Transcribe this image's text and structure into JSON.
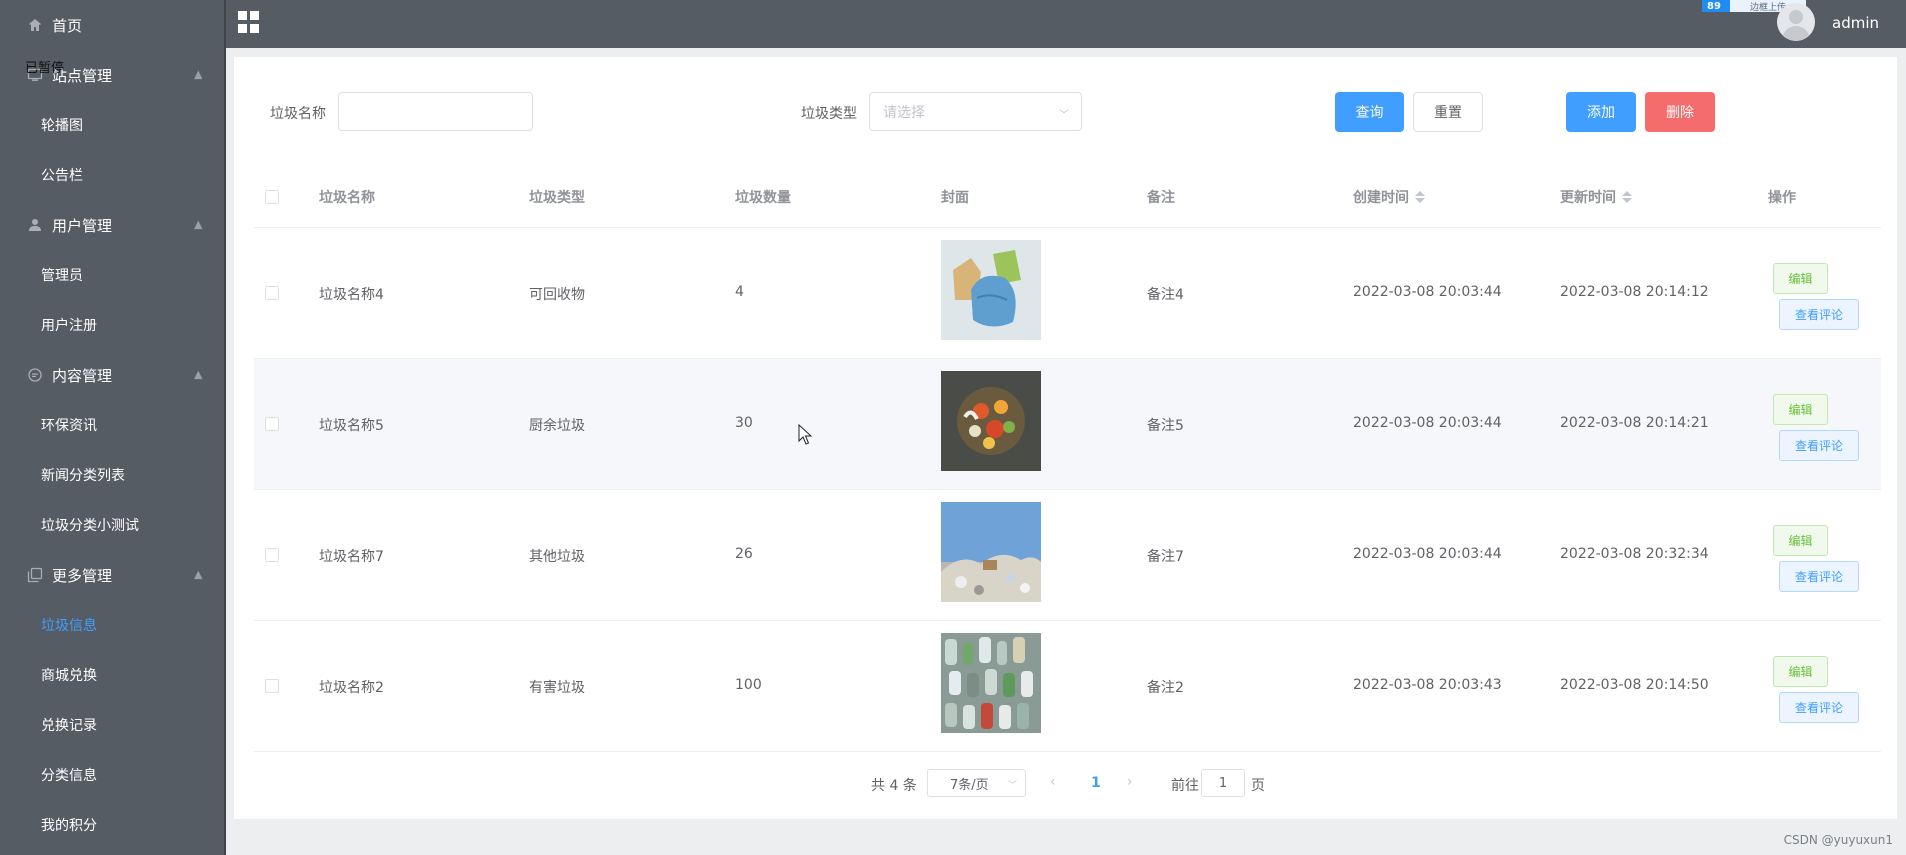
{
  "sidebar": {
    "paused_label": "已暂停",
    "items": [
      {
        "label": "首页",
        "icon": "home-icon",
        "type": "menu"
      },
      {
        "label": "站点管理",
        "icon": "monitor-icon",
        "type": "menu",
        "expanded": true
      },
      {
        "label": "轮播图",
        "type": "sub"
      },
      {
        "label": "公告栏",
        "type": "sub"
      },
      {
        "label": "用户管理",
        "icon": "user-icon",
        "type": "menu",
        "expanded": true
      },
      {
        "label": "管理员",
        "type": "sub"
      },
      {
        "label": "用户注册",
        "type": "sub"
      },
      {
        "label": "内容管理",
        "icon": "chat-icon",
        "type": "menu",
        "expanded": true
      },
      {
        "label": "环保资讯",
        "type": "sub"
      },
      {
        "label": "新闻分类列表",
        "type": "sub"
      },
      {
        "label": "垃圾分类小测试",
        "type": "sub"
      },
      {
        "label": "更多管理",
        "icon": "copy-icon",
        "type": "menu",
        "expanded": true
      },
      {
        "label": "垃圾信息",
        "type": "sub",
        "active": true
      },
      {
        "label": "商城兑换",
        "type": "sub"
      },
      {
        "label": "兑换记录",
        "type": "sub"
      },
      {
        "label": "分类信息",
        "type": "sub"
      },
      {
        "label": "我的积分",
        "type": "sub"
      }
    ]
  },
  "topbar": {
    "username": "admin",
    "upload_badge": {
      "left": "89",
      "right": "边框上传"
    }
  },
  "search": {
    "name_label": "垃圾名称",
    "name_value": "",
    "type_label": "垃圾类型",
    "type_placeholder": "请选择",
    "query_button": "查询",
    "reset_button": "重置",
    "add_button": "添加",
    "delete_button": "删除"
  },
  "table": {
    "headers": {
      "name": "垃圾名称",
      "type": "垃圾类型",
      "count": "垃圾数量",
      "cover": "封面",
      "remark": "备注",
      "created": "创建时间",
      "updated": "更新时间",
      "actions": "操作"
    },
    "edit_label": "编辑",
    "view_label": "查看评论",
    "rows": [
      {
        "name": "垃圾名称4",
        "type": "可回收物",
        "count": "4",
        "remark": "备注4",
        "created": "2022-03-08 20:03:44",
        "updated": "2022-03-08 20:14:12",
        "cover": "recyclable-bags"
      },
      {
        "name": "垃圾名称5",
        "type": "厨余垃圾",
        "count": "30",
        "remark": "备注5",
        "created": "2022-03-08 20:03:44",
        "updated": "2022-03-08 20:14:21",
        "cover": "food-waste"
      },
      {
        "name": "垃圾名称7",
        "type": "其他垃圾",
        "count": "26",
        "remark": "备注7",
        "created": "2022-03-08 20:03:44",
        "updated": "2022-03-08 20:32:34",
        "cover": "litter-pile"
      },
      {
        "name": "垃圾名称2",
        "type": "有害垃圾",
        "count": "100",
        "remark": "备注2",
        "created": "2022-03-08 20:03:43",
        "updated": "2022-03-08 20:14:50",
        "cover": "plastic-bottles"
      }
    ]
  },
  "pagination": {
    "total": "共 4 条",
    "page_size": "7条/页",
    "current": "1",
    "goto_label": "前往",
    "goto_value": "1",
    "page_unit": "页"
  },
  "watermark": "CSDN @yuyuxun1",
  "colors": {
    "sidebar_bg": "#565c64",
    "primary": "#409eff",
    "danger": "#f56c6c",
    "success": "#67c23a"
  }
}
